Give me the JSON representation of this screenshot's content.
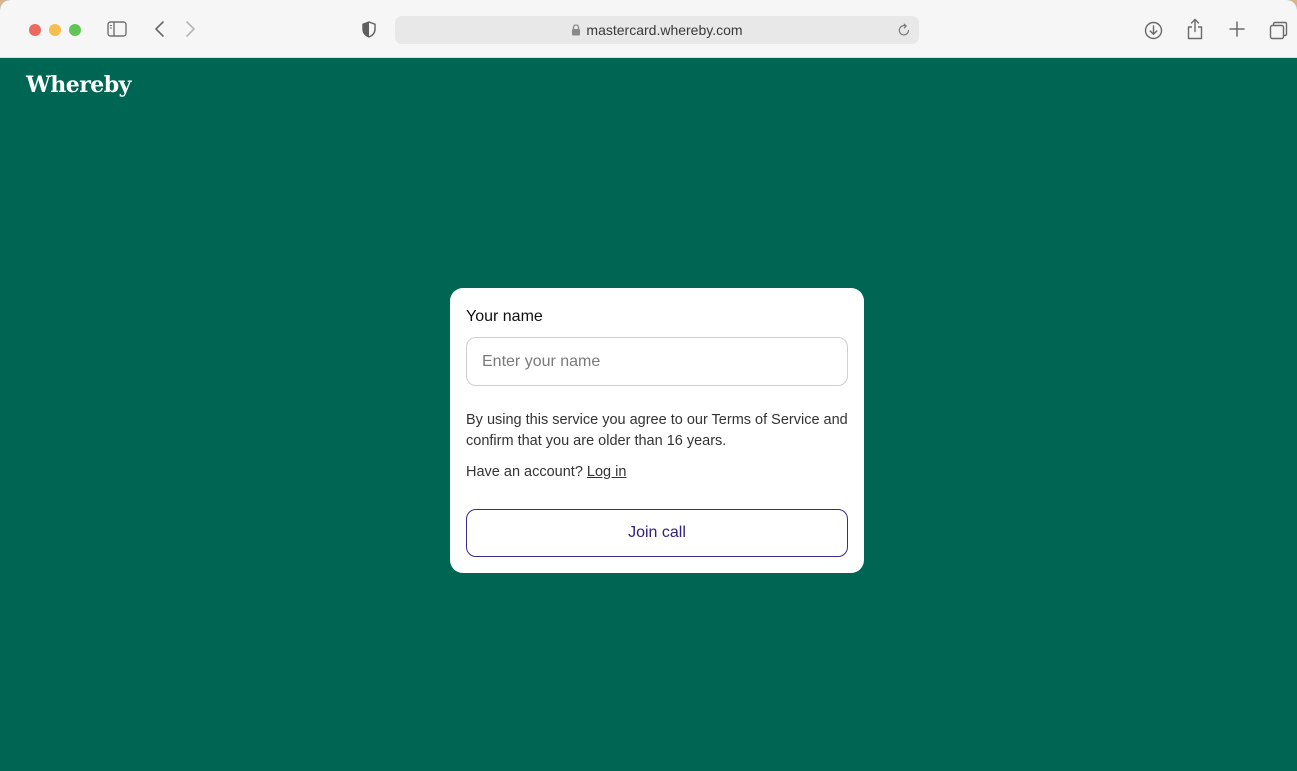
{
  "browser": {
    "url": "mastercard.whereby.com",
    "icons": {
      "sidebar": "sidebar-icon",
      "back": "chevron-left-icon",
      "forward": "chevron-right-icon",
      "privacy": "shield-icon",
      "lock": "lock-icon",
      "reload": "reload-icon",
      "download": "download-icon",
      "share": "share-icon",
      "new_tab": "plus-icon",
      "tab_overview": "tabs-icon"
    },
    "traffic_lights": [
      "#ed6a5e",
      "#f5bf4f",
      "#61c554"
    ]
  },
  "page": {
    "logo": "Whereby",
    "background_color": "#006654",
    "form": {
      "name_label": "Your name",
      "name_value": "",
      "name_placeholder": "Enter your name",
      "terms_text": "By using this service you agree to our Terms of Service and confirm that you are older than 16 years.",
      "account_prompt": "Have an account?",
      "login_label": "Log in",
      "join_label": "Join call",
      "join_color": "#2e2480"
    }
  }
}
